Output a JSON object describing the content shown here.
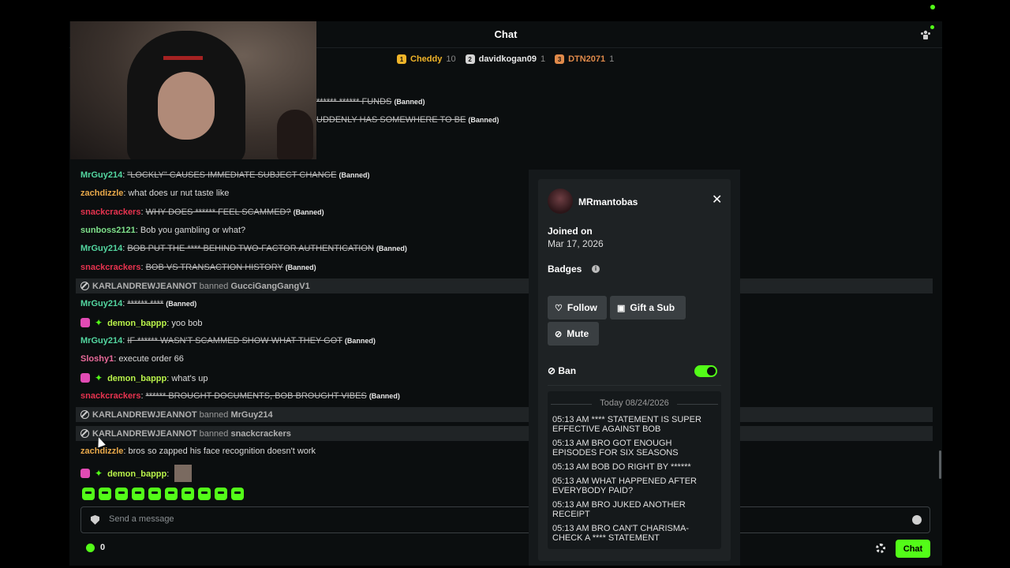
{
  "header": {
    "title": "Chat"
  },
  "leaderboard": [
    {
      "rank": "1",
      "name": "Cheddy",
      "count": "10",
      "color": "#f0b429"
    },
    {
      "rank": "2",
      "name": "davidkogan09",
      "count": "1",
      "color": "#d5d5d5"
    },
    {
      "rank": "3",
      "name": "DTN2071",
      "count": "1",
      "color": "#e08a4a"
    }
  ],
  "messages": {
    "m0_text": "****** ****** FUNDS",
    "m0_tag": "(Banned)",
    "m1_text": "UDDENLY HAS SOMEWHERE TO BE",
    "m1_tag": "(Banned)",
    "m2_user": "MrGuy214",
    "m2_text": "\"LOCKLY\" CAUSES IMMEDIATE SUBJECT CHANGE",
    "m2_tag": "(Banned)",
    "m3_user": "zachdizzle",
    "m3_text": "what does ur nut taste like",
    "m4_user": "snackcrackers",
    "m4_text": "WHY DOES ****** FEEL SCAMMED?",
    "m4_tag": "(Banned)",
    "m5_user": "sunboss2121",
    "m5_text": "Bob you gambling or what?",
    "m6_user": "MrGuy214",
    "m6_text": "BOB PUT THE **** BEHIND TWO-FACTOR AUTHENTICATION",
    "m6_tag": "(Banned)",
    "m7_user": "snackcrackers",
    "m7_text": "BOB VS TRANSACTION HISTORY",
    "m7_tag": "(Banned)",
    "s1_mod": "KARLANDREWJEANNOT",
    "s1_verb": "banned",
    "s1_target": "GucciGangGangV1",
    "m8_user": "MrGuy214",
    "m8_text": "****** ****",
    "m8_tag": "(Banned)",
    "m9_user": "demon_bappp",
    "m9_text": "yoo bob",
    "m10_user": "MrGuy214",
    "m10_text": "IF ****** WASN'T SCAMMED SHOW WHAT THEY GOT",
    "m10_tag": "(Banned)",
    "m11_user": "Sloshy1",
    "m11_text": "execute order 66",
    "m12_user": "demon_bappp",
    "m12_text": "what's up",
    "m13_user": "snackcrackers",
    "m13_text": "****** BROUGHT DOCUMENTS, BOB BROUGHT VIBES",
    "m13_tag": "(Banned)",
    "s2_mod": "KARLANDREWJEANNOT",
    "s2_verb": "banned",
    "s2_target": "MrGuy214",
    "s3_mod": "KARLANDREWJEANNOT",
    "s3_verb": "banned",
    "s3_target": "snackcrackers",
    "m14_user": "zachdizzle",
    "m14_text": "bros so zapped his face recognition doesn't work",
    "m15_user": "demon_bappp",
    "sep": ":"
  },
  "colors": {
    "mrguy": "#53d6a0",
    "zach": "#e9a94a",
    "snack": "#e8334f",
    "sunboss": "#7ee08a",
    "demon": "#b9f24a",
    "sloshy": "#e86a9a",
    "accent": "#53fc18"
  },
  "input": {
    "placeholder": "Send a message"
  },
  "footer": {
    "points": "0",
    "send_label": "Chat"
  },
  "card": {
    "username": "MRmantobas",
    "joined_label": "Joined on",
    "joined_date": "Mar 17, 2026",
    "badges_label": "Badges",
    "follow": "Follow",
    "gift": "Gift a Sub",
    "mute": "Mute",
    "ban_label": "Ban",
    "ban_enabled": true,
    "history_date": "Today 08/24/2026",
    "history": [
      "05:13 AM **** STATEMENT IS SUPER EFFECTIVE AGAINST BOB",
      "05:13 AM BRO GOT ENOUGH EPISODES FOR SIX SEASONS",
      "05:13 AM BOB DO RIGHT BY ******",
      "05:13 AM WHAT HAPPENED AFTER EVERYBODY PAID?",
      "05:13 AM BRO JUKED ANOTHER RECEIPT",
      "05:13 AM BRO CAN'T CHARISMA-CHECK A **** STATEMENT"
    ]
  }
}
